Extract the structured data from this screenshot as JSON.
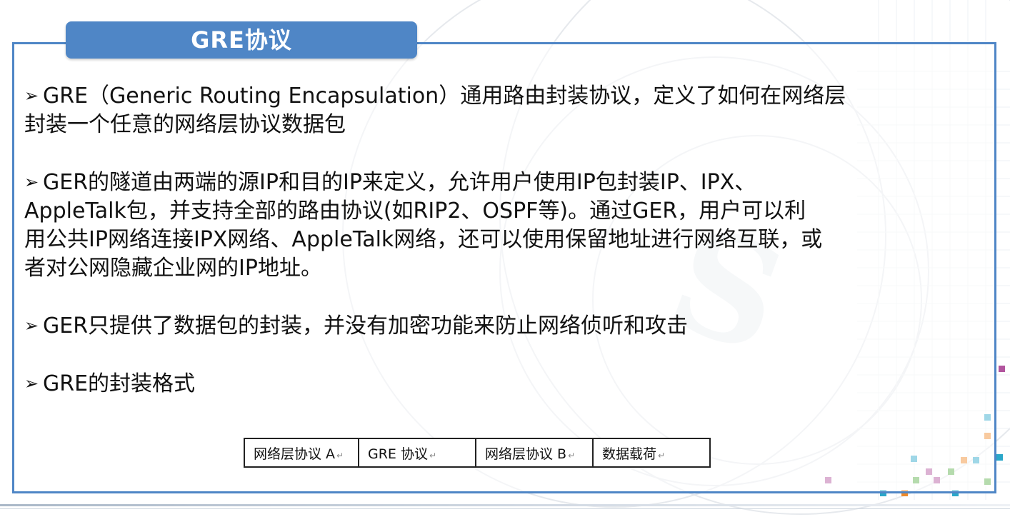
{
  "title": "GRE协议",
  "bullet_marker": "➢",
  "bullets": [
    {
      "lines": [
        "GRE（Generic Routing Encapsulation）通用路由封装协议，定义了如何在网络层",
        "封装一个任意的网络层协议数据包"
      ]
    },
    {
      "lines": [
        "GER的隧道由两端的源IP和目的IP来定义，允许用户使用IP包封装IP、IPX、",
        "AppleTalk包，并支持全部的路由协议(如RIP2、OSPF等)。通过GER，用户可以利",
        "用公共IP网络连接IPX网络、AppleTalk网络，还可以使用保留地址进行网络互联，或",
        "者对公网隐藏企业网的IP地址。"
      ]
    },
    {
      "lines": [
        "GER只提供了数据包的封装，并没有加密功能来防止网络侦听和攻击"
      ]
    },
    {
      "lines": [
        "GRE的封装格式"
      ]
    }
  ],
  "format_table": {
    "cells": [
      "网络层协议 A",
      "GRE 协议",
      "网络层协议 B",
      "数据载荷"
    ],
    "return_mark": "↵"
  },
  "colors": {
    "accent": "#4f86c6",
    "text": "#111111"
  }
}
